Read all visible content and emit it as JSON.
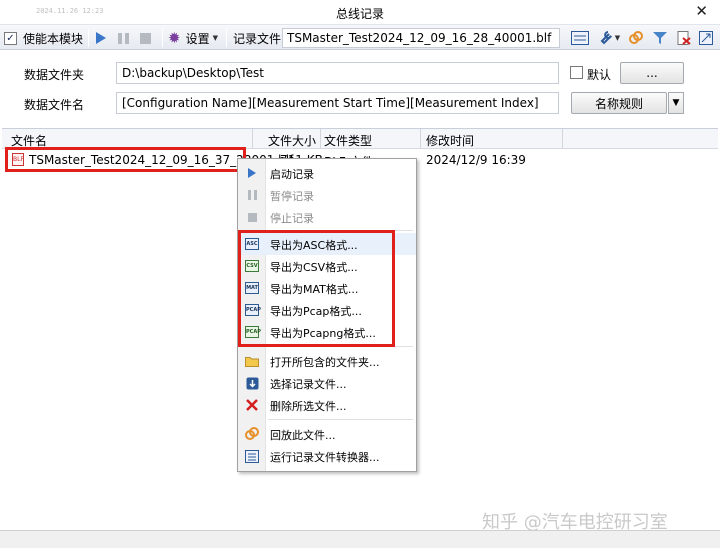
{
  "window": {
    "timestamp": "2024.11.26 12:23",
    "title": "总线记录",
    "close_glyph": "✕"
  },
  "toolbar": {
    "enable_label": "使能本模块",
    "enable_checked": true,
    "settings_label": "设置",
    "record_file_label": "记录文件:",
    "record_file_value": "TSMaster_Test2024_12_09_16_28_40001.blf",
    "icons": [
      "play-icon",
      "pause-icon",
      "stop-icon",
      "gear-icon",
      "grid-icon",
      "wrench-icon",
      "link-icon",
      "filter-icon",
      "delete-file-icon",
      "resize-icon"
    ]
  },
  "folder": {
    "label": "数据文件夹",
    "value": "D:\\backup\\Desktop\\Test",
    "default_label": "默认",
    "browse_label": "..."
  },
  "filename": {
    "label": "数据文件名",
    "value": "[Configuration Name][Measurement Start Time][Measurement Index]",
    "naming_rule_label": "名称规则"
  },
  "table": {
    "columns": [
      "文件名",
      "文件大小",
      "文件类型",
      "修改时间"
    ],
    "rows": [
      {
        "name": "TSMaster_Test2024_12_09_16_37_28001.blf",
        "size": "711 KB",
        "type": "BLF 文件",
        "modified": "2024/12/9 16:39"
      }
    ]
  },
  "context_menu": {
    "items": [
      {
        "label": "启动记录",
        "icon": "play-icon",
        "enabled": true
      },
      {
        "label": "暂停记录",
        "icon": "pause-icon",
        "enabled": false
      },
      {
        "label": "停止记录",
        "icon": "stop-icon",
        "enabled": false
      },
      {
        "label": "导出为ASC格式...",
        "icon": "asc-icon",
        "badge": "ASC"
      },
      {
        "label": "导出为CSV格式...",
        "icon": "csv-icon",
        "badge": "CSV"
      },
      {
        "label": "导出为MAT格式...",
        "icon": "mat-icon",
        "badge": "MAT"
      },
      {
        "label": "导出为Pcap格式...",
        "icon": "pcap-icon",
        "badge": "PCAP"
      },
      {
        "label": "导出为Pcapng格式...",
        "icon": "pcapng-icon",
        "badge": "PCAP"
      },
      {
        "label": "打开所包含的文件夹...",
        "icon": "folder-icon"
      },
      {
        "label": "选择记录文件...",
        "icon": "select-file-icon"
      },
      {
        "label": "删除所选文件...",
        "icon": "delete-icon"
      },
      {
        "label": "回放此文件...",
        "icon": "replay-icon"
      },
      {
        "label": "运行记录文件转换器...",
        "icon": "converter-icon"
      }
    ]
  },
  "watermark": "知乎 @汽车电控研习室",
  "colors": {
    "highlight_red": "#e0201b",
    "accent_blue": "#3a76c8",
    "menu_hover": "#e8f1fb"
  }
}
